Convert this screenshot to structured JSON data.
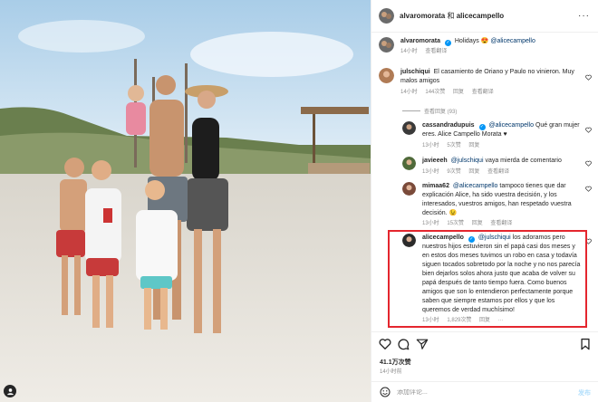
{
  "post": {
    "photo_alt": "",
    "header": {
      "author": "alvaromorata",
      "joiner": "和",
      "coauthor": "alicecampello",
      "more_icon": "ellipsis-icon"
    },
    "caption": {
      "username": "alvaromorata",
      "text": "Holidays",
      "emoji": "😍",
      "mention": "@alicecampello",
      "time": "14小时",
      "translate": "查看翻译"
    }
  },
  "comments": [
    {
      "username": "julschiqui",
      "text": "El casamiento de Oriano y Paulo no vinieron. Muy malos amigos",
      "time": "14小时",
      "likes": "144次赞",
      "reply": "回复",
      "translate": "查看翻译",
      "replies_toggle": "查看回复 (93)",
      "replies": [
        {
          "username": "cassandradupuis",
          "verified": true,
          "mention": "@alicecampello",
          "text": "Qué gran mujer eres. Alice Campello Morata ♥",
          "time": "13小时",
          "likes": "5次赞",
          "reply": "回复"
        },
        {
          "username": "javieeeh",
          "verified": false,
          "mention": "@julschiqui",
          "text": "vaya mierda de comentario",
          "time": "13小时",
          "likes": "9次赞",
          "reply": "回复",
          "translate": "查看翻译"
        },
        {
          "username": "mimaa62",
          "verified": false,
          "mention": "@alicecampello",
          "text": "tampoco tienes que dar explicación Alice, ha sido vuestra decisión, y los interesados, vuestros amigos, han respetado vuestra decisión. 😉",
          "time": "13小时",
          "likes": "15次赞",
          "reply": "回复",
          "translate": "查看翻译"
        },
        {
          "username": "alicecampello",
          "verified": true,
          "mention": "@julschiqui",
          "text": "los adoramos pero nuestros hijos estuvieron sin el papá casi dos meses y en estos dos meses tuvimos un robo en casa y todavía siguen tocados sobretodo por la noche y no nos parecía bien dejarlos solos ahora justo que acaba de volver su papá después de tanto tiempo fuera. Como buenos amigos que son lo entendieron perfectamente porque saben que siempre estamos por ellos y que los queremos de verdad muchísimo!",
          "time": "13小时",
          "likes": "1,829次赞",
          "reply": "回复",
          "more": "···"
        }
      ]
    }
  ],
  "actions": {
    "like_icon": "heart-icon",
    "comment_icon": "comment-icon",
    "share_icon": "share-icon",
    "save_icon": "bookmark-icon",
    "likes_count": "41.1万次赞",
    "time": "14小时前"
  },
  "add_comment": {
    "placeholder": "添加评论...",
    "post_label": "发布",
    "emoji_icon": "emoji-icon"
  },
  "colors": {
    "verified": "#0095f6",
    "highlight": "#e4262e",
    "link": "#00376b",
    "muted": "#8e8e8e"
  }
}
